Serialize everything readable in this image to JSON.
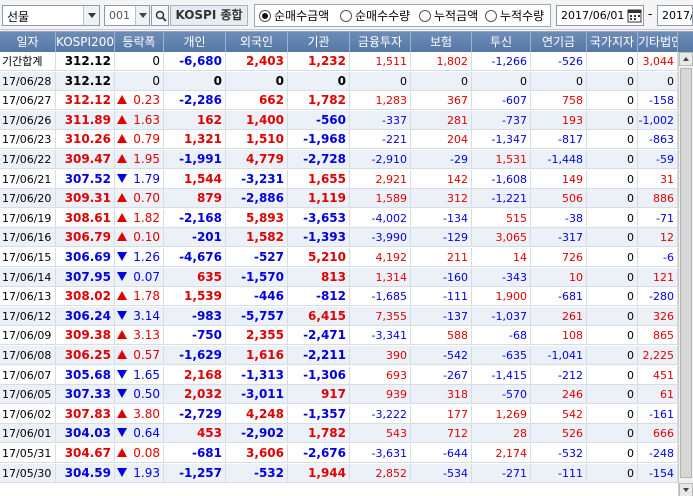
{
  "toolbar": {
    "market_select": "선물",
    "code_value": "001",
    "name_value": "KOSPI 종합",
    "radios": [
      {
        "label": "순매수금액",
        "checked": true
      },
      {
        "label": "순매수수량",
        "checked": false
      },
      {
        "label": "누적금액",
        "checked": false
      },
      {
        "label": "누적수량",
        "checked": false
      }
    ],
    "date_from": "2017/06/01",
    "date_sep": "-",
    "date_to": "2017/"
  },
  "grid": {
    "headers": [
      "일자",
      "KOSPI200",
      "등락폭",
      "개인",
      "외국인",
      "기관",
      "금융투자",
      "보험",
      "투신",
      "연기금",
      "국가지자",
      "기타법인"
    ],
    "rows": [
      {
        "date": "기간합계",
        "kospi": "312.12",
        "dir": "",
        "chg": "0",
        "indiv": "-6,680",
        "foreign": "2,403",
        "inst": "1,232",
        "fin": "1,511",
        "ins": "1,802",
        "trust": "-1,266",
        "pension": "-526",
        "gov": "0",
        "etc": "3,044",
        "kc": "blk"
      },
      {
        "date": "17/06/28",
        "kospi": "312.12",
        "dir": "",
        "chg": "0",
        "indiv": "0",
        "foreign": "0",
        "inst": "0",
        "fin": "0",
        "ins": "0",
        "trust": "0",
        "pension": "0",
        "gov": "0",
        "etc": "0",
        "kc": "blk"
      },
      {
        "date": "17/06/27",
        "kospi": "312.12",
        "dir": "up",
        "chg": "0.23",
        "indiv": "-2,286",
        "foreign": "662",
        "inst": "1,782",
        "fin": "1,283",
        "ins": "367",
        "trust": "-607",
        "pension": "758",
        "gov": "0",
        "etc": "-158",
        "kc": "red"
      },
      {
        "date": "17/06/26",
        "kospi": "311.89",
        "dir": "up",
        "chg": "1.63",
        "indiv": "162",
        "foreign": "1,400",
        "inst": "-560",
        "fin": "-337",
        "ins": "281",
        "trust": "-737",
        "pension": "193",
        "gov": "0",
        "etc": "-1,002",
        "kc": "red"
      },
      {
        "date": "17/06/23",
        "kospi": "310.26",
        "dir": "up",
        "chg": "0.79",
        "indiv": "1,321",
        "foreign": "1,510",
        "inst": "-1,968",
        "fin": "-221",
        "ins": "204",
        "trust": "-1,347",
        "pension": "-817",
        "gov": "0",
        "etc": "-863",
        "kc": "red"
      },
      {
        "date": "17/06/22",
        "kospi": "309.47",
        "dir": "up",
        "chg": "1.95",
        "indiv": "-1,991",
        "foreign": "4,779",
        "inst": "-2,728",
        "fin": "-2,910",
        "ins": "-29",
        "trust": "1,531",
        "pension": "-1,448",
        "gov": "0",
        "etc": "-59",
        "kc": "red"
      },
      {
        "date": "17/06/21",
        "kospi": "307.52",
        "dir": "down",
        "chg": "1.79",
        "indiv": "1,544",
        "foreign": "-3,231",
        "inst": "1,655",
        "fin": "2,921",
        "ins": "142",
        "trust": "-1,608",
        "pension": "149",
        "gov": "0",
        "etc": "31",
        "kc": "blue"
      },
      {
        "date": "17/06/20",
        "kospi": "309.31",
        "dir": "up",
        "chg": "0.70",
        "indiv": "879",
        "foreign": "-2,886",
        "inst": "1,119",
        "fin": "1,589",
        "ins": "312",
        "trust": "-1,221",
        "pension": "506",
        "gov": "0",
        "etc": "886",
        "kc": "red"
      },
      {
        "date": "17/06/19",
        "kospi": "308.61",
        "dir": "up",
        "chg": "1.82",
        "indiv": "-2,168",
        "foreign": "5,893",
        "inst": "-3,653",
        "fin": "-4,002",
        "ins": "-134",
        "trust": "515",
        "pension": "-38",
        "gov": "0",
        "etc": "-71",
        "kc": "red"
      },
      {
        "date": "17/06/16",
        "kospi": "306.79",
        "dir": "up",
        "chg": "0.10",
        "indiv": "-201",
        "foreign": "1,582",
        "inst": "-1,393",
        "fin": "-3,990",
        "ins": "-129",
        "trust": "3,065",
        "pension": "-317",
        "gov": "0",
        "etc": "12",
        "kc": "red"
      },
      {
        "date": "17/06/15",
        "kospi": "306.69",
        "dir": "down",
        "chg": "1.26",
        "indiv": "-4,676",
        "foreign": "-527",
        "inst": "5,210",
        "fin": "4,192",
        "ins": "211",
        "trust": "14",
        "pension": "726",
        "gov": "0",
        "etc": "-6",
        "kc": "blue"
      },
      {
        "date": "17/06/14",
        "kospi": "307.95",
        "dir": "down",
        "chg": "0.07",
        "indiv": "635",
        "foreign": "-1,570",
        "inst": "813",
        "fin": "1,314",
        "ins": "-160",
        "trust": "-343",
        "pension": "10",
        "gov": "0",
        "etc": "121",
        "kc": "blue"
      },
      {
        "date": "17/06/13",
        "kospi": "308.02",
        "dir": "up",
        "chg": "1.78",
        "indiv": "1,539",
        "foreign": "-446",
        "inst": "-812",
        "fin": "-1,685",
        "ins": "-111",
        "trust": "1,900",
        "pension": "-681",
        "gov": "0",
        "etc": "-280",
        "kc": "red"
      },
      {
        "date": "17/06/12",
        "kospi": "306.24",
        "dir": "down",
        "chg": "3.14",
        "indiv": "-983",
        "foreign": "-5,757",
        "inst": "6,415",
        "fin": "7,355",
        "ins": "-137",
        "trust": "-1,037",
        "pension": "261",
        "gov": "0",
        "etc": "326",
        "kc": "blue"
      },
      {
        "date": "17/06/09",
        "kospi": "309.38",
        "dir": "up",
        "chg": "3.13",
        "indiv": "-750",
        "foreign": "2,355",
        "inst": "-2,471",
        "fin": "-3,341",
        "ins": "588",
        "trust": "-68",
        "pension": "108",
        "gov": "0",
        "etc": "865",
        "kc": "red"
      },
      {
        "date": "17/06/08",
        "kospi": "306.25",
        "dir": "up",
        "chg": "0.57",
        "indiv": "-1,629",
        "foreign": "1,616",
        "inst": "-2,211",
        "fin": "390",
        "ins": "-542",
        "trust": "-635",
        "pension": "-1,041",
        "gov": "0",
        "etc": "2,225",
        "kc": "red"
      },
      {
        "date": "17/06/07",
        "kospi": "305.68",
        "dir": "down",
        "chg": "1.65",
        "indiv": "2,168",
        "foreign": "-1,313",
        "inst": "-1,306",
        "fin": "693",
        "ins": "-267",
        "trust": "-1,415",
        "pension": "-212",
        "gov": "0",
        "etc": "451",
        "kc": "blue"
      },
      {
        "date": "17/06/05",
        "kospi": "307.33",
        "dir": "down",
        "chg": "0.50",
        "indiv": "2,032",
        "foreign": "-3,011",
        "inst": "917",
        "fin": "939",
        "ins": "318",
        "trust": "-570",
        "pension": "246",
        "gov": "0",
        "etc": "61",
        "kc": "blue"
      },
      {
        "date": "17/06/02",
        "kospi": "307.83",
        "dir": "up",
        "chg": "3.80",
        "indiv": "-2,729",
        "foreign": "4,248",
        "inst": "-1,357",
        "fin": "-3,222",
        "ins": "177",
        "trust": "1,269",
        "pension": "542",
        "gov": "0",
        "etc": "-161",
        "kc": "red"
      },
      {
        "date": "17/06/01",
        "kospi": "304.03",
        "dir": "down",
        "chg": "0.64",
        "indiv": "453",
        "foreign": "-2,902",
        "inst": "1,782",
        "fin": "543",
        "ins": "712",
        "trust": "28",
        "pension": "526",
        "gov": "0",
        "etc": "666",
        "kc": "blue"
      },
      {
        "date": "17/05/31",
        "kospi": "304.67",
        "dir": "up",
        "chg": "0.08",
        "indiv": "-681",
        "foreign": "3,606",
        "inst": "-2,676",
        "fin": "-3,631",
        "ins": "-644",
        "trust": "2,174",
        "pension": "-532",
        "gov": "0",
        "etc": "-248",
        "kc": "red"
      },
      {
        "date": "17/05/30",
        "kospi": "304.59",
        "dir": "down",
        "chg": "1.93",
        "indiv": "-1,257",
        "foreign": "-532",
        "inst": "1,944",
        "fin": "2,852",
        "ins": "-534",
        "trust": "-271",
        "pension": "-111",
        "gov": "0",
        "etc": "-154",
        "kc": "blue"
      }
    ]
  },
  "colors": {
    "header": "#5e7fae",
    "up": "#e00000",
    "down": "#0000e0",
    "alt_row": "#ecf1f8"
  }
}
